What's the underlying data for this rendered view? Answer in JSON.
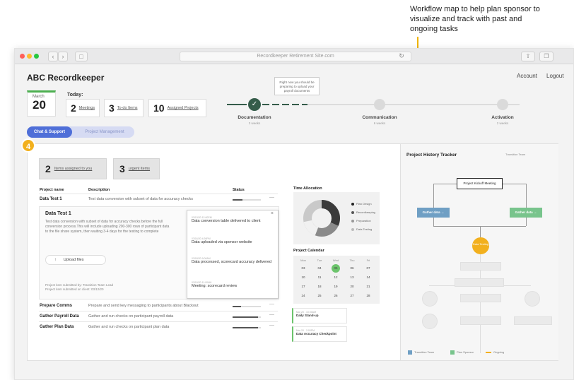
{
  "annotation": "Workflow map to help plan sponsor to visualize and track with past and ongoing tasks",
  "browser": {
    "url": "Recordkeeper Retirement Site.com",
    "nav_back": "‹",
    "nav_forward": "›",
    "sidebar_glyph": "□",
    "reload_glyph": "↻",
    "share_glyph": "⇧",
    "tabs_glyph": "❐"
  },
  "header": {
    "app_title": "ABC Recordkeeper",
    "account": "Account",
    "logout": "Logout"
  },
  "date": {
    "month": "March",
    "day": "20"
  },
  "today": {
    "label": "Today:",
    "meetings": {
      "count": "2",
      "label": "Meetings"
    },
    "todo": {
      "count": "3",
      "label": "To-do Items"
    },
    "projects": {
      "count": "10",
      "label": "Assigned Projects"
    }
  },
  "stepper": {
    "tooltip": "Right now you should be preparing to upload your payroll documents",
    "check_glyph": "✓",
    "steps": [
      {
        "label": "Documentation",
        "sub": "3 weeks"
      },
      {
        "label": "Communication",
        "sub": "6 weeks"
      },
      {
        "label": "Activation",
        "sub": "2 weeks"
      }
    ]
  },
  "tabs": {
    "active": "Chat & Support",
    "inactive": "Project Management"
  },
  "main": {
    "badge": "4",
    "assigned": {
      "count": "2",
      "label": "Items assigned to you"
    },
    "urgent": {
      "count": "3",
      "label": "urgent items"
    },
    "table_headers": {
      "name": "Project name",
      "desc": "Description",
      "status": "Status"
    },
    "more_glyph": "—",
    "close_glyph": "×",
    "upload_glyph": "↑",
    "rows": [
      {
        "name": "Data Test 1",
        "desc": "Test data conversion with subset of data for accuracy checks",
        "progress": 0.35
      },
      {
        "name": "Prepare Comms",
        "desc": "Prepare and send key messaging to participants about Blackout",
        "progress": 0.3
      },
      {
        "name": "Gather Payroll Data",
        "desc": "Gather and run checks on participant payroll data",
        "progress": 0.9
      },
      {
        "name": "Gather Plan Data",
        "desc": "Gather and run checks on participant plan data",
        "progress": 0.9
      }
    ],
    "detail": {
      "title": "Data Test 1",
      "body": "Test data conversion with subset of data for accuracy checks before the full conversion process.This will include uploading 200-300 rows of participant data to the file share system, then waiting 3-4 days for the testing to complete",
      "upload": "Upload files",
      "submitted_by": "Project item submitted by: Transition Team Lead",
      "submitted_on": "Project item submitted on client: 03/12/20",
      "timeline": [
        {
          "date": "03/13/20 12:00PM",
          "event": "Data conversion table delivered to client"
        },
        {
          "date": "03/16/20 4:30PM",
          "event": "Data uploaded via sponsor website"
        },
        {
          "date": "03/18/20 9:00AM",
          "event": "Data processed, scorecard accuracy delivered"
        },
        {
          "date": "03/19/20 11:00AM",
          "event": "Meeting: scorecard review"
        }
      ]
    },
    "time_allocation": {
      "title": "Time Allocation",
      "legend": [
        "Plan Design",
        "Recordkeeping",
        "Preparation",
        "Data Testing"
      ]
    },
    "calendar": {
      "title": "Project Calendar",
      "days": [
        "Mon",
        "Tue",
        "Wed",
        "Thu",
        "Fri"
      ],
      "weeks": [
        [
          "03",
          "04",
          "05",
          "06",
          "07"
        ],
        [
          "10",
          "11",
          "12",
          "13",
          "14"
        ],
        [
          "17",
          "18",
          "19",
          "20",
          "21"
        ],
        [
          "24",
          "25",
          "26",
          "27",
          "28"
        ]
      ],
      "selected": "05"
    },
    "events": [
      {
        "date": "Mar 20 - 10:00AM",
        "title": "Daily Stand-up"
      },
      {
        "date": "Mar 20 - 2:00PM",
        "title": "Data Accuracy Checkpoint"
      }
    ]
  },
  "tracker": {
    "title": "Project History Tracker",
    "sub": "Transition Team",
    "kickoff": "Project Kickoff Meeting",
    "gather_left": "Gather data  →",
    "gather_right": "Gather data  →",
    "ongoing_node": "Data Testing",
    "legend": [
      "Transition Team",
      "Plan Sponsor",
      "Ongoing"
    ],
    "colors": {
      "team": "#6f9fc4",
      "sponsor": "#78c48c",
      "ongoing": "#f2b01e"
    }
  }
}
